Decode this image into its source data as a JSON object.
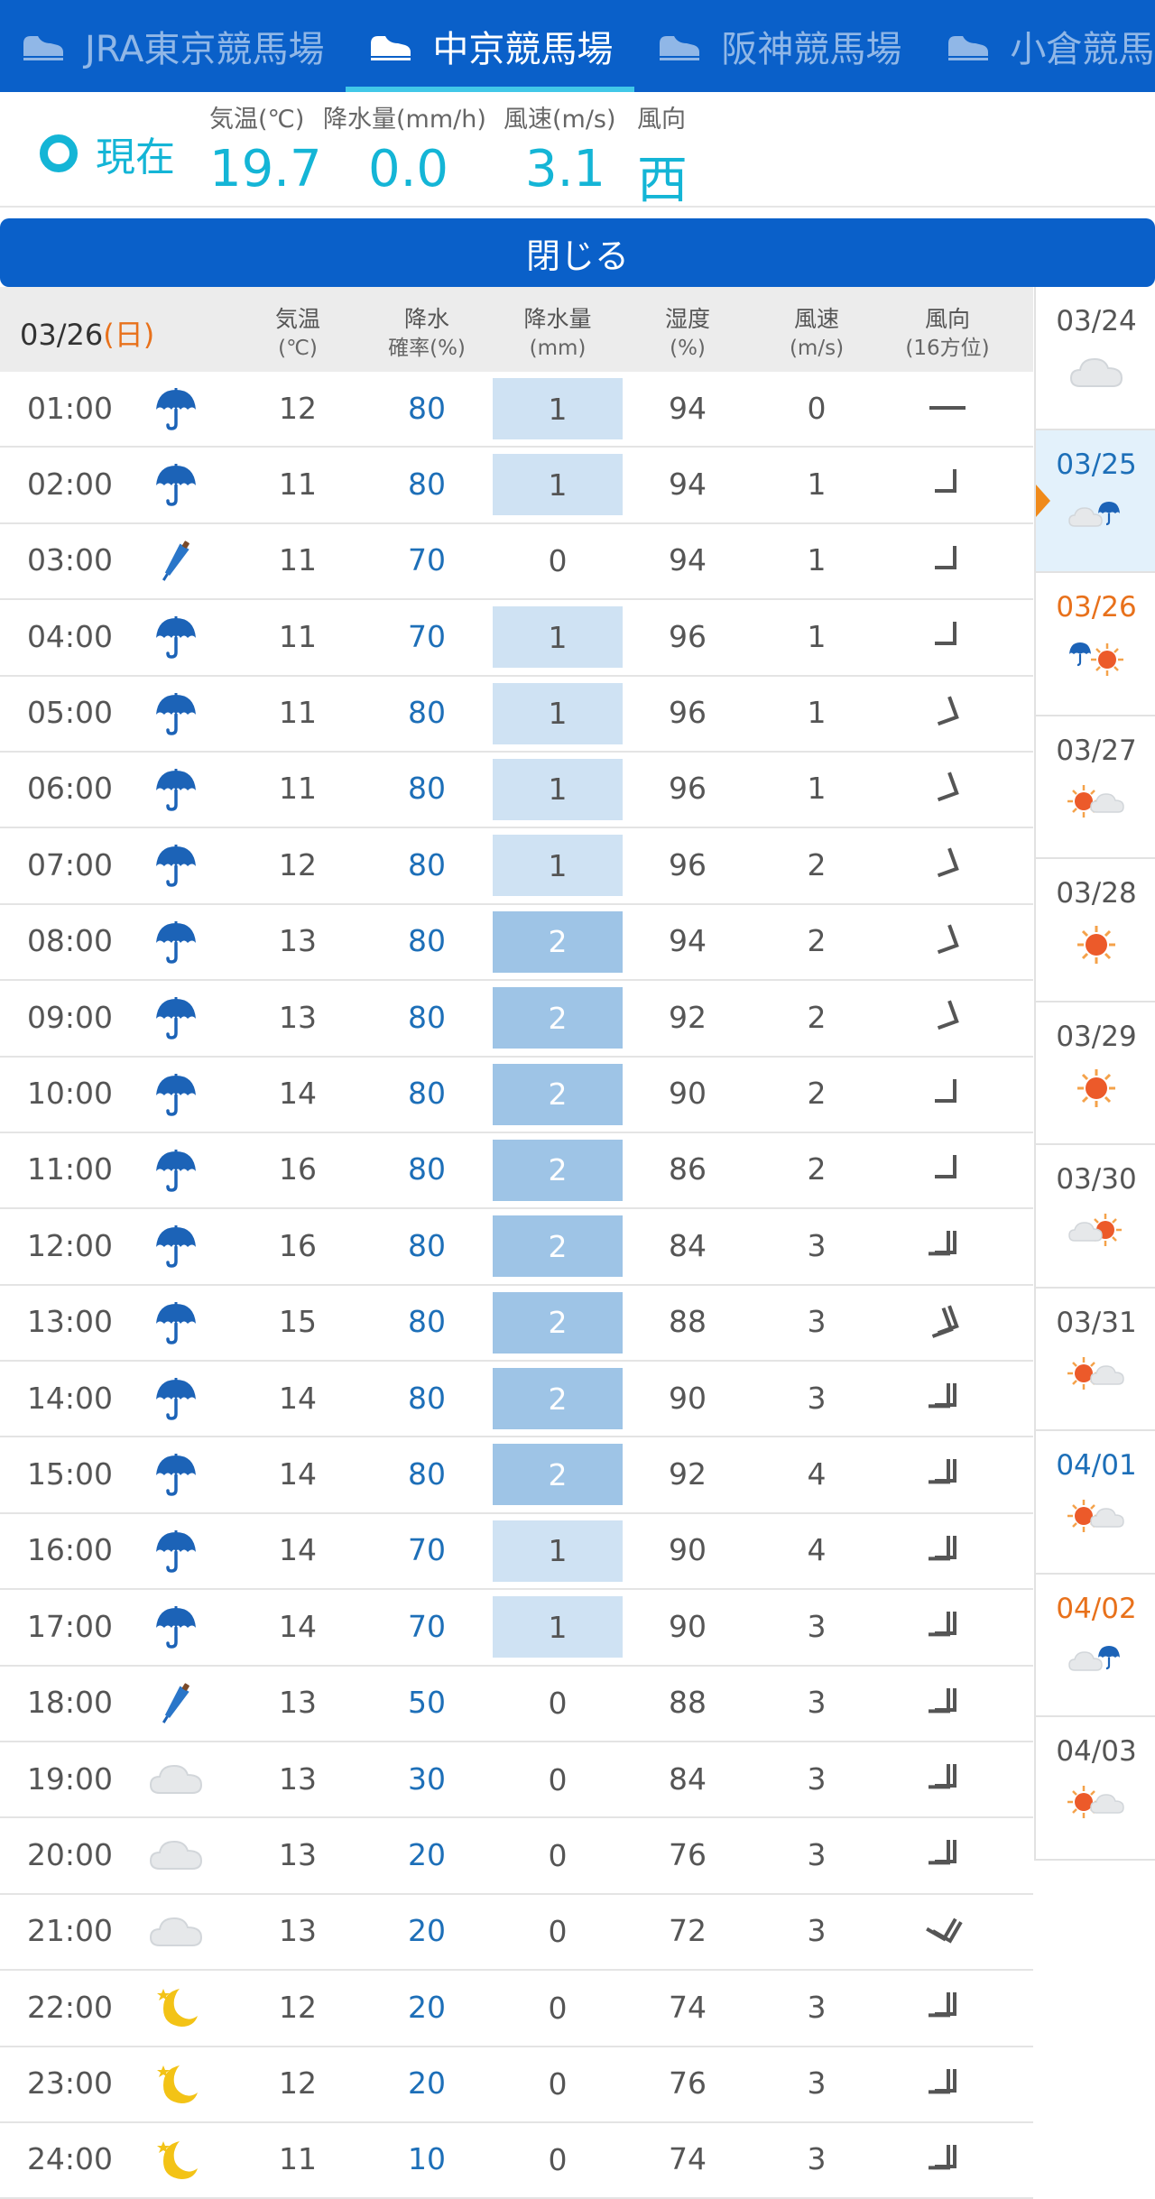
{
  "tabs": [
    {
      "label": "JRA東京競馬場",
      "active": false
    },
    {
      "label": "中京競馬場",
      "active": true
    },
    {
      "label": "阪神競馬場",
      "active": false
    },
    {
      "label": "小倉競馬場",
      "active": false
    }
  ],
  "current": {
    "label": "現在",
    "metrics": [
      {
        "label": "気温(℃)",
        "value": "19.7"
      },
      {
        "label": "降水量(mm/h)",
        "value": "0.0"
      },
      {
        "label": "風速(m/s)",
        "value": "3.1"
      },
      {
        "label": "風向",
        "value": "西"
      }
    ]
  },
  "close_label": "閉じる",
  "table": {
    "date": "03/26",
    "day_open": "(",
    "day": "日",
    "day_close": ")",
    "headers": [
      {
        "label": "気温",
        "unit": "(℃)"
      },
      {
        "label": "降水",
        "unit": "確率(%)"
      },
      {
        "label": "降水量",
        "unit": "(mm)"
      },
      {
        "label": "湿度",
        "unit": "(%)"
      },
      {
        "label": "風速",
        "unit": "(m/s)"
      },
      {
        "label": "風向",
        "unit": "(16方位)"
      }
    ],
    "rows": [
      {
        "time": "01:00",
        "icon": "umbrella-icon",
        "temp": "12",
        "prob": "80",
        "amount": "1",
        "hum": "94",
        "wind": "0",
        "dir": "calm"
      },
      {
        "time": "02:00",
        "icon": "umbrella-icon",
        "temp": "11",
        "prob": "80",
        "amount": "1",
        "hum": "94",
        "wind": "1",
        "dir": "1"
      },
      {
        "time": "03:00",
        "icon": "closed-umbrella-icon",
        "temp": "11",
        "prob": "70",
        "amount": "0",
        "hum": "94",
        "wind": "1",
        "dir": "1"
      },
      {
        "time": "04:00",
        "icon": "umbrella-icon",
        "temp": "11",
        "prob": "70",
        "amount": "1",
        "hum": "96",
        "wind": "1",
        "dir": "1"
      },
      {
        "time": "05:00",
        "icon": "umbrella-icon",
        "temp": "11",
        "prob": "80",
        "amount": "1",
        "hum": "96",
        "wind": "1",
        "dir": "1r"
      },
      {
        "time": "06:00",
        "icon": "umbrella-icon",
        "temp": "11",
        "prob": "80",
        "amount": "1",
        "hum": "96",
        "wind": "1",
        "dir": "1r"
      },
      {
        "time": "07:00",
        "icon": "umbrella-icon",
        "temp": "12",
        "prob": "80",
        "amount": "1",
        "hum": "96",
        "wind": "2",
        "dir": "1r"
      },
      {
        "time": "08:00",
        "icon": "umbrella-icon",
        "temp": "13",
        "prob": "80",
        "amount": "2",
        "hum": "94",
        "wind": "2",
        "dir": "1r"
      },
      {
        "time": "09:00",
        "icon": "umbrella-icon",
        "temp": "13",
        "prob": "80",
        "amount": "2",
        "hum": "92",
        "wind": "2",
        "dir": "1r"
      },
      {
        "time": "10:00",
        "icon": "umbrella-icon",
        "temp": "14",
        "prob": "80",
        "amount": "2",
        "hum": "90",
        "wind": "2",
        "dir": "1"
      },
      {
        "time": "11:00",
        "icon": "umbrella-icon",
        "temp": "16",
        "prob": "80",
        "amount": "2",
        "hum": "86",
        "wind": "2",
        "dir": "1"
      },
      {
        "time": "12:00",
        "icon": "umbrella-icon",
        "temp": "16",
        "prob": "80",
        "amount": "2",
        "hum": "84",
        "wind": "3",
        "dir": "2"
      },
      {
        "time": "13:00",
        "icon": "umbrella-icon",
        "temp": "15",
        "prob": "80",
        "amount": "2",
        "hum": "88",
        "wind": "3",
        "dir": "2r"
      },
      {
        "time": "14:00",
        "icon": "umbrella-icon",
        "temp": "14",
        "prob": "80",
        "amount": "2",
        "hum": "90",
        "wind": "3",
        "dir": "2"
      },
      {
        "time": "15:00",
        "icon": "umbrella-icon",
        "temp": "14",
        "prob": "80",
        "amount": "2",
        "hum": "92",
        "wind": "4",
        "dir": "2"
      },
      {
        "time": "16:00",
        "icon": "umbrella-icon",
        "temp": "14",
        "prob": "70",
        "amount": "1",
        "hum": "90",
        "wind": "4",
        "dir": "2"
      },
      {
        "time": "17:00",
        "icon": "umbrella-icon",
        "temp": "14",
        "prob": "70",
        "amount": "1",
        "hum": "90",
        "wind": "3",
        "dir": "2"
      },
      {
        "time": "18:00",
        "icon": "closed-umbrella-icon",
        "temp": "13",
        "prob": "50",
        "amount": "0",
        "hum": "88",
        "wind": "3",
        "dir": "2"
      },
      {
        "time": "19:00",
        "icon": "cloud-icon",
        "temp": "13",
        "prob": "30",
        "amount": "0",
        "hum": "84",
        "wind": "3",
        "dir": "2"
      },
      {
        "time": "20:00",
        "icon": "cloud-icon",
        "temp": "13",
        "prob": "20",
        "amount": "0",
        "hum": "76",
        "wind": "3",
        "dir": "2"
      },
      {
        "time": "21:00",
        "icon": "cloud-icon",
        "temp": "13",
        "prob": "20",
        "amount": "0",
        "hum": "72",
        "wind": "3",
        "dir": "2l"
      },
      {
        "time": "22:00",
        "icon": "moon-icon",
        "temp": "12",
        "prob": "20",
        "amount": "0",
        "hum": "74",
        "wind": "3",
        "dir": "2"
      },
      {
        "time": "23:00",
        "icon": "moon-icon",
        "temp": "12",
        "prob": "20",
        "amount": "0",
        "hum": "76",
        "wind": "3",
        "dir": "2"
      },
      {
        "time": "24:00",
        "icon": "moon-icon",
        "temp": "11",
        "prob": "10",
        "amount": "0",
        "hum": "74",
        "wind": "3",
        "dir": "2"
      }
    ]
  },
  "daily": [
    {
      "date": "03/24",
      "icon": "cloud-icon",
      "type": "weekday",
      "selected": false
    },
    {
      "date": "03/25",
      "icon": "cloud-umbrella-icon",
      "type": "weekday",
      "selected": true
    },
    {
      "date": "03/26",
      "icon": "umbrella-sun-icon",
      "type": "sun",
      "selected": false
    },
    {
      "date": "03/27",
      "icon": "sun-cloud-icon",
      "type": "weekday",
      "selected": false
    },
    {
      "date": "03/28",
      "icon": "sun-icon",
      "type": "weekday",
      "selected": false
    },
    {
      "date": "03/29",
      "icon": "sun-icon",
      "type": "weekday",
      "selected": false
    },
    {
      "date": "03/30",
      "icon": "cloud-sun-icon",
      "type": "weekday",
      "selected": false
    },
    {
      "date": "03/31",
      "icon": "sun-cloud-icon",
      "type": "weekday",
      "selected": false
    },
    {
      "date": "04/01",
      "icon": "sun-cloud-icon",
      "type": "sat",
      "selected": false
    },
    {
      "date": "04/02",
      "icon": "cloud-umbrella-icon",
      "type": "sun",
      "selected": false
    },
    {
      "date": "04/03",
      "icon": "sun-cloud-icon",
      "type": "weekday",
      "selected": false
    }
  ],
  "colors": {
    "brand_blue": "#0a60c9",
    "accent_cyan": "#14b5d6",
    "sunday_orange": "#e8711b",
    "saturday_blue": "#1d6fb8",
    "rain_light": "#cfe2f3",
    "rain_medium": "#9ec4e6"
  }
}
